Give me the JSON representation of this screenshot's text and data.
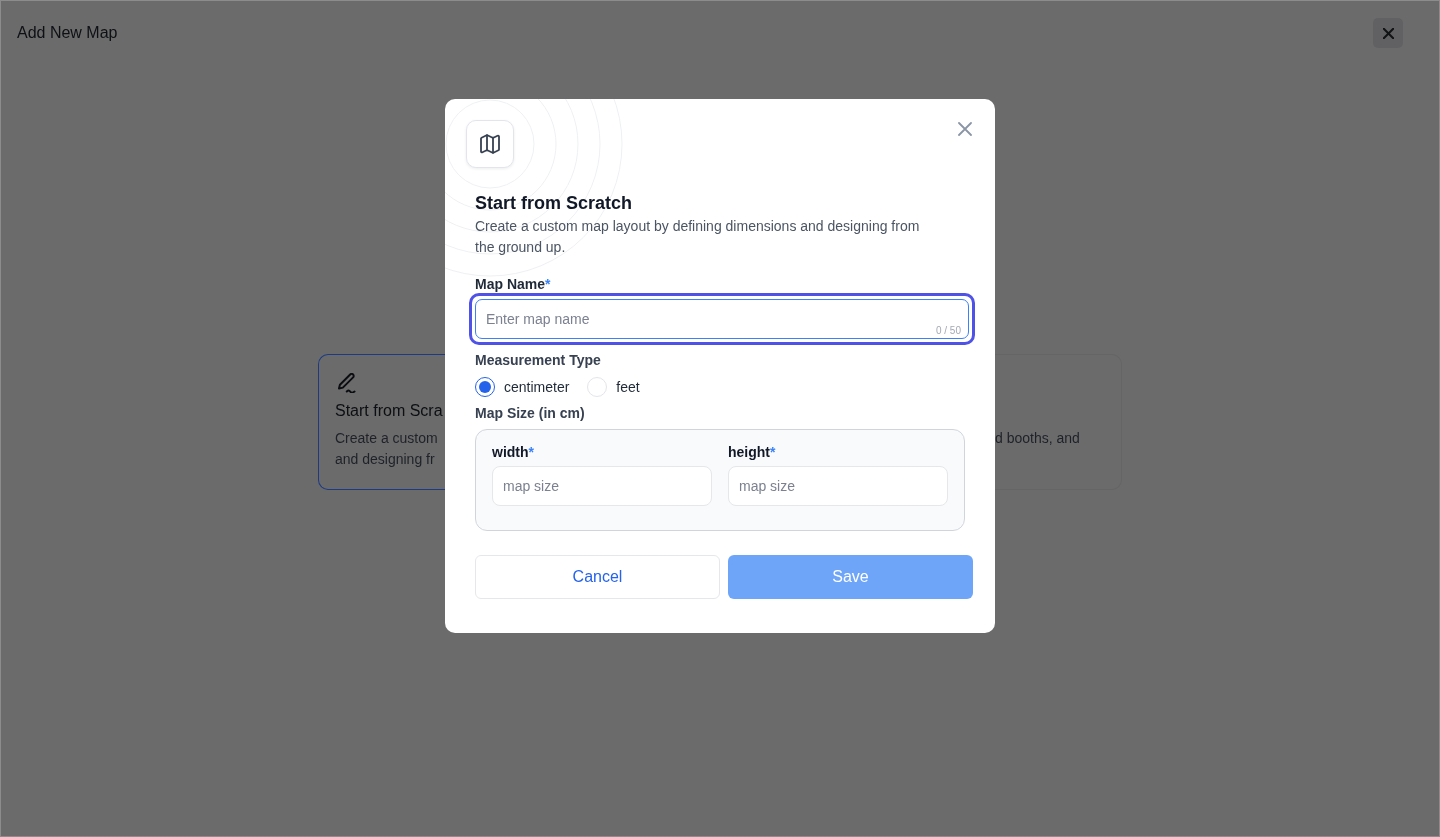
{
  "page": {
    "title": "Add New Map"
  },
  "cards": [
    {
      "title": "Start from Scra",
      "description_lines": [
        "Create a custom",
        "and designing fr"
      ],
      "selected": true
    },
    {
      "description_lines": [
        "d booths, and"
      ],
      "selected": false
    }
  ],
  "dialog": {
    "title": "Start from Scratch",
    "description": "Create a custom map layout by defining dimensions and designing from the ground up.",
    "map_name": {
      "label": "Map Name",
      "required_mark": "*",
      "placeholder": "Enter map name",
      "counter": "0 / 50",
      "focused": true
    },
    "measurement": {
      "label": "Measurement Type",
      "options": [
        {
          "label": "centimeter",
          "selected": true
        },
        {
          "label": "feet",
          "selected": false
        }
      ]
    },
    "map_size": {
      "label": "Map Size (in cm)",
      "fields": [
        {
          "label": "width",
          "required_mark": "*",
          "placeholder": "map size"
        },
        {
          "label": "height",
          "required_mark": "*",
          "placeholder": "map size"
        }
      ]
    },
    "buttons": [
      {
        "label": "Cancel",
        "kind": "secondary",
        "disabled": false
      },
      {
        "label": "Save",
        "kind": "primary",
        "disabled": true
      }
    ]
  }
}
